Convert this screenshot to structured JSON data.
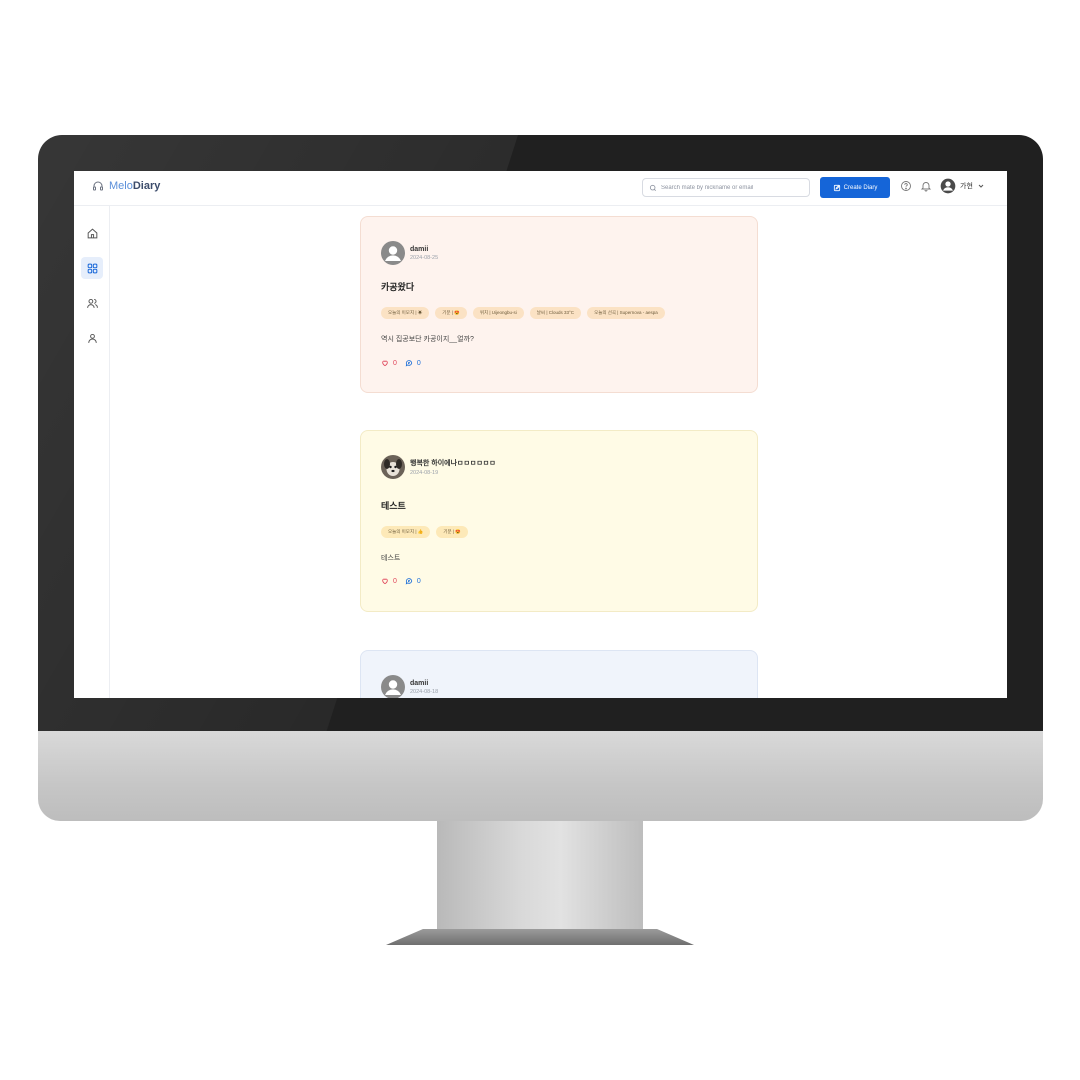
{
  "app": {
    "logo_prefix": "Melo",
    "logo_suffix": "Diary"
  },
  "header": {
    "search_placeholder": "Search mate by nickname or email",
    "create_label": "Create Diary",
    "user_name": "가현"
  },
  "sidebar": {
    "items": [
      {
        "name": "home",
        "active": false
      },
      {
        "name": "grid",
        "active": true
      },
      {
        "name": "users",
        "active": false
      },
      {
        "name": "profile",
        "active": false
      }
    ]
  },
  "posts": [
    {
      "author": "damii",
      "date": "2024-08-25",
      "title": "카공왔다",
      "tags": [
        "오늘의 이모지 | ☀",
        "기분 | 😍",
        "위치 | Uijeongbu-si",
        "날씨 | Clouds 33°C",
        "오늘의 선곡 | Supernova - aespa"
      ],
      "body": "역시 집공보단 카공이지__얼까?",
      "likes": "0",
      "comments": "0",
      "bg": "#fef3ee"
    },
    {
      "author": "행복한 하이에나ㅁㅁㅁㅁㅁㅁ",
      "date": "2024-08-19",
      "title": "테스트",
      "tags": [
        "오늘의 이모지 | 👍",
        "기분 | 😍"
      ],
      "body": "테스트",
      "likes": "0",
      "comments": "0",
      "bg": "#fffbe6"
    },
    {
      "author": "damii",
      "date": "2024-08-18",
      "bg": "#f0f4fb"
    }
  ],
  "colors": {
    "primary": "#1565d8",
    "like": "#e0445a",
    "comment": "#1d6fd8"
  }
}
